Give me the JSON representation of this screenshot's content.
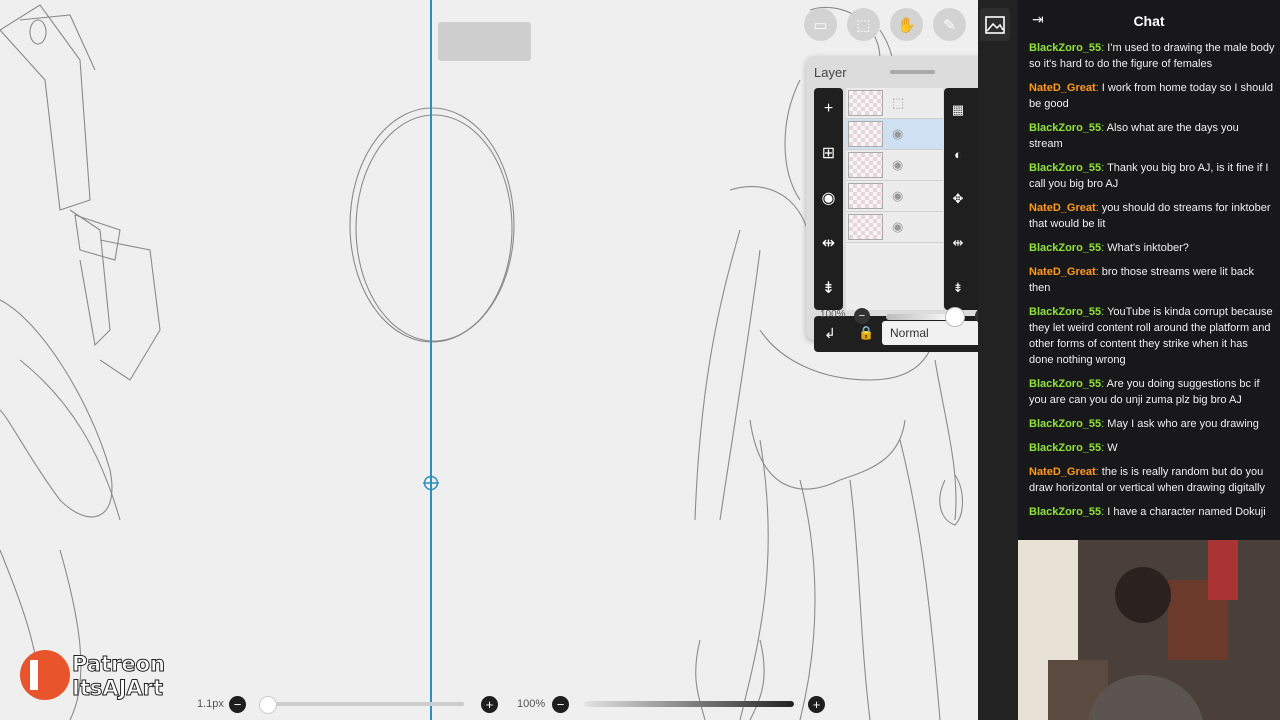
{
  "canvas": {
    "brush_size": "1.1px",
    "zoom": "100%",
    "watermark": {
      "line1": "Patreon",
      "line2": "ItsAJArt"
    }
  },
  "top_tools": [
    {
      "icon": "selection-icon"
    },
    {
      "icon": "transform-icon"
    },
    {
      "icon": "hand-icon"
    },
    {
      "icon": "pen-icon"
    },
    {
      "icon": "gallery-icon"
    }
  ],
  "layer_panel": {
    "title": "Layer",
    "close_icon": "close-icon",
    "blend_mode": "Normal",
    "opacity": "100%",
    "layers_count_visible": 5
  },
  "chat": {
    "title": "Chat",
    "colors": {
      "BlackZoro_55": "#8fe33c",
      "NateD_Great": "#ff9a1f"
    },
    "messages": [
      {
        "user": "BlackZoro_55",
        "text": "I'm used to drawing the male body so it's hard to do the figure of females"
      },
      {
        "user": "NateD_Great",
        "text": "I work from home today so I should be good"
      },
      {
        "user": "BlackZoro_55",
        "text": "Also what are the days you stream"
      },
      {
        "user": "BlackZoro_55",
        "text": "Thank you big bro AJ, is it fine if I call you big bro AJ"
      },
      {
        "user": "NateD_Great",
        "text": "you should do streams for inktober that would be lit"
      },
      {
        "user": "BlackZoro_55",
        "text": "What's inktober?"
      },
      {
        "user": "NateD_Great",
        "text": "bro those streams were lit back then"
      },
      {
        "user": "BlackZoro_55",
        "text": "YouTube is kinda corrupt because they let weird content roll around the platform and other forms of content they strike when it has done nothing wrong"
      },
      {
        "user": "BlackZoro_55",
        "text": "Are you doing suggestions bc if you are can you do unji zuma plz big bro AJ"
      },
      {
        "user": "BlackZoro_55",
        "text": "May I ask who are you drawing"
      },
      {
        "user": "BlackZoro_55",
        "text": "W"
      },
      {
        "user": "NateD_Great",
        "text": "the is is really random but do you draw horizontal or vertical when drawing digitally"
      },
      {
        "user": "BlackZoro_55",
        "text": "I have a character named Dokuji"
      }
    ]
  }
}
